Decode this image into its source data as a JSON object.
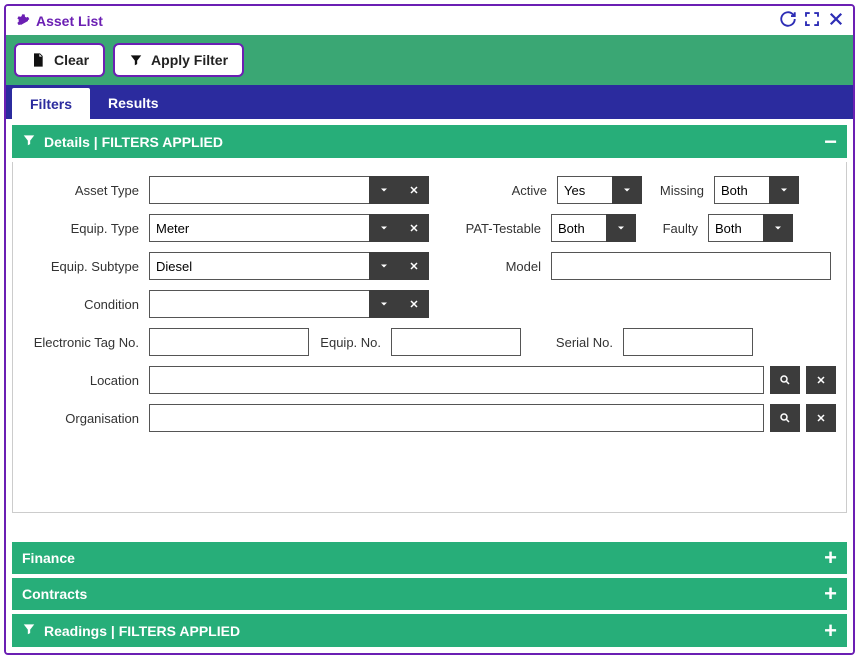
{
  "window": {
    "title": "Asset List"
  },
  "toolbar": {
    "clear": "Clear",
    "apply": "Apply Filter"
  },
  "tabs": {
    "filters": "Filters",
    "results": "Results"
  },
  "panels": {
    "details": {
      "title": "Details | FILTERS APPLIED"
    },
    "finance": {
      "title": "Finance"
    },
    "contracts": {
      "title": "Contracts"
    },
    "readings": {
      "title": "Readings | FILTERS APPLIED"
    }
  },
  "labels": {
    "asset_type": "Asset Type",
    "equip_type": "Equip. Type",
    "equip_subtype": "Equip. Subtype",
    "condition": "Condition",
    "etag": "Electronic Tag No.",
    "equip_no": "Equip. No.",
    "location": "Location",
    "organisation": "Organisation",
    "active": "Active",
    "pat": "PAT-Testable",
    "model": "Model",
    "missing": "Missing",
    "faulty": "Faulty",
    "serial": "Serial No."
  },
  "values": {
    "asset_type": "",
    "equip_type": "Meter",
    "equip_subtype": "Diesel",
    "condition": "",
    "etag": "",
    "equip_no": "",
    "location": "",
    "organisation": "",
    "active": "Yes",
    "pat": "Both",
    "model": "",
    "missing": "Both",
    "faulty": "Both",
    "serial": ""
  }
}
